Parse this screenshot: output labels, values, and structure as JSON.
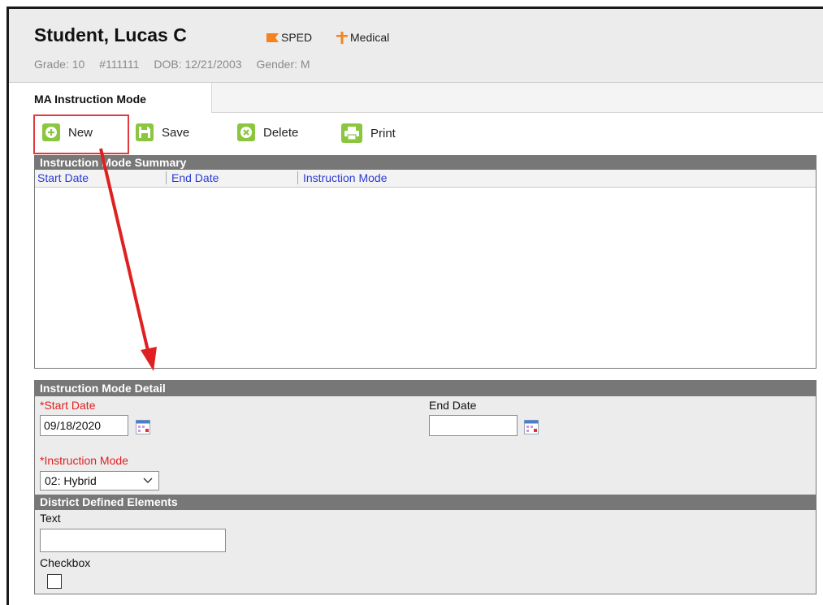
{
  "student": {
    "name": "Student, Lucas C",
    "flags": [
      {
        "label": "SPED",
        "color": "#f5821f"
      },
      {
        "label": "Medical",
        "color": "#f5821f"
      }
    ],
    "grade": "Grade: 10",
    "id": "#111111",
    "dob": "DOB: 12/21/2003",
    "gender": "Gender: M"
  },
  "tab": {
    "label": "MA Instruction Mode"
  },
  "toolbar": {
    "new_label": "New",
    "save_label": "Save",
    "delete_label": "Delete",
    "print_label": "Print",
    "icon_color": "#8bc63f"
  },
  "summary": {
    "title": "Instruction Mode Summary",
    "columns": [
      "Start Date",
      "End Date",
      "Instruction Mode"
    ]
  },
  "detail": {
    "title": "Instruction Mode Detail",
    "start_date_label": "*Start Date",
    "start_date_value": "09/18/2020",
    "end_date_label": "End Date",
    "end_date_value": "",
    "mode_label": "*Instruction Mode",
    "mode_value": "02: Hybrid",
    "district_title": "District Defined Elements",
    "text_label": "Text",
    "text_value": "",
    "checkbox_label": "Checkbox",
    "checkbox_checked": false
  },
  "annotation_color": "#e03a3a"
}
